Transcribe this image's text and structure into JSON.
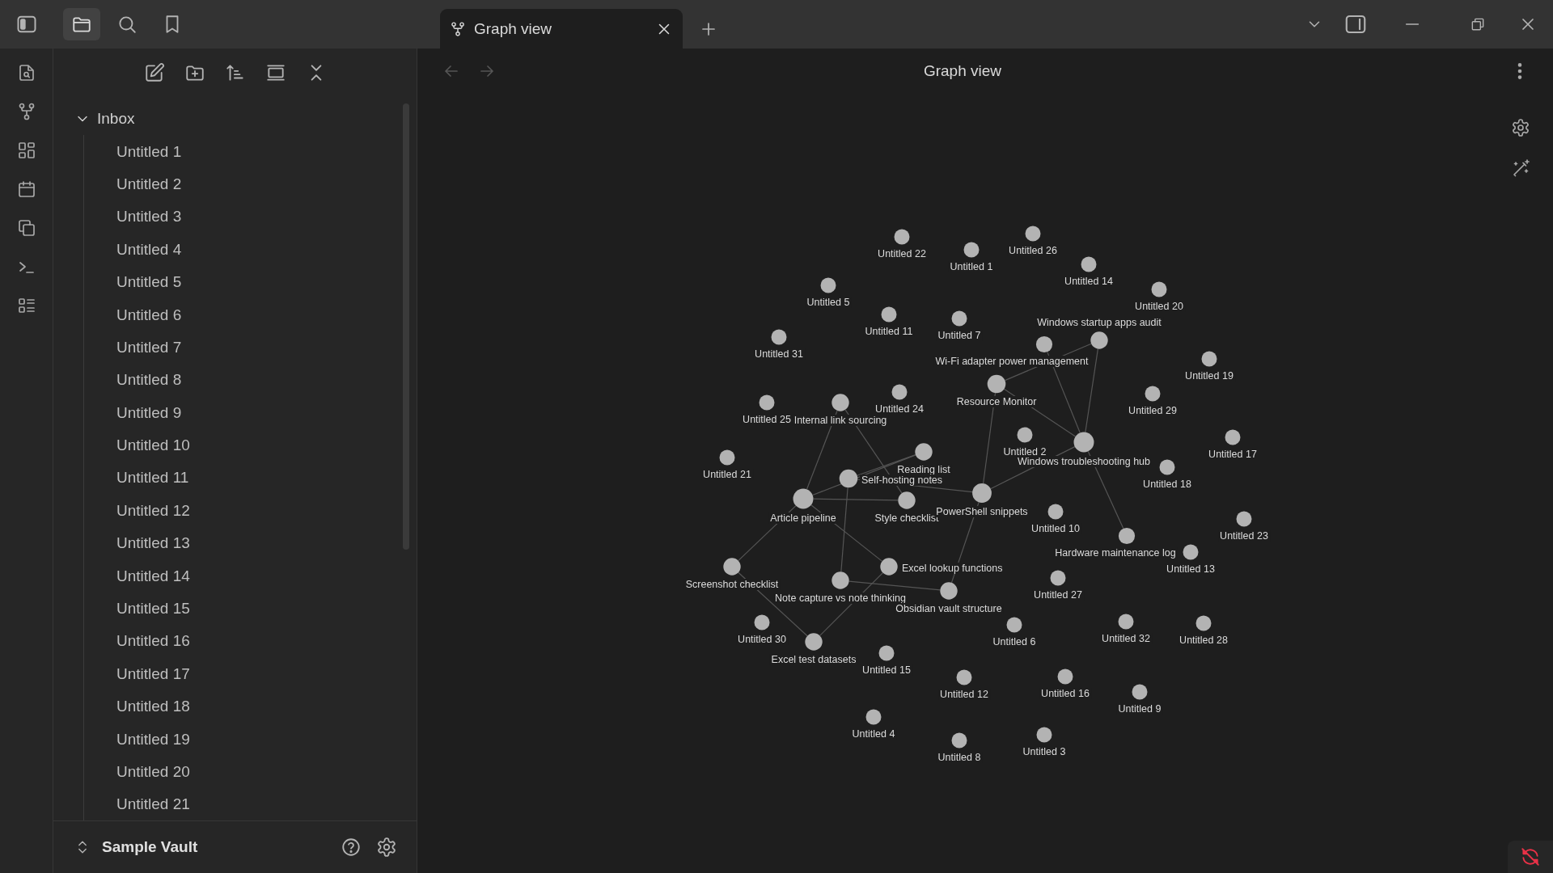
{
  "sidebar_tabs": [
    {
      "kind": "files",
      "selected": true
    },
    {
      "kind": "search",
      "selected": false
    },
    {
      "kind": "bookmarks",
      "selected": false
    }
  ],
  "tabs": [
    {
      "label": "Graph view",
      "selected": true
    }
  ],
  "explorer": {
    "tree": [
      {
        "label": "Inbox",
        "expanded": true,
        "children": [
          {
            "label": "Untitled 1"
          },
          {
            "label": "Untitled 2"
          },
          {
            "label": "Untitled 3"
          },
          {
            "label": "Untitled 4"
          },
          {
            "label": "Untitled 5"
          },
          {
            "label": "Untitled 6"
          },
          {
            "label": "Untitled 7"
          },
          {
            "label": "Untitled 8"
          },
          {
            "label": "Untitled 9"
          },
          {
            "label": "Untitled 10"
          },
          {
            "label": "Untitled 11"
          },
          {
            "label": "Untitled 12"
          },
          {
            "label": "Untitled 13"
          },
          {
            "label": "Untitled 14"
          },
          {
            "label": "Untitled 15"
          },
          {
            "label": "Untitled 16"
          },
          {
            "label": "Untitled 17"
          },
          {
            "label": "Untitled 18"
          },
          {
            "label": "Untitled 19"
          },
          {
            "label": "Untitled 20"
          },
          {
            "label": "Untitled 21"
          }
        ]
      }
    ],
    "vault": "Sample Vault"
  },
  "graph_view": {
    "title": "Graph view",
    "back": {
      "disabled": true
    },
    "forward": {
      "disabled": true
    },
    "nodes": [
      {
        "label": "Untitled 22"
      },
      {
        "label": "Untitled 1"
      },
      {
        "label": "Untitled 26"
      },
      {
        "label": "Untitled 14"
      },
      {
        "label": "Untitled 20"
      },
      {
        "label": "Untitled 5"
      },
      {
        "label": "Untitled 11"
      },
      {
        "label": "Untitled 7"
      },
      {
        "label": "Untitled 31"
      },
      {
        "label": "Wi-Fi adapter power management"
      },
      {
        "label": "Windows startup apps audit"
      },
      {
        "label": "Untitled 19"
      },
      {
        "label": "Resource Monitor"
      },
      {
        "label": "Untitled 29"
      },
      {
        "label": "Untitled 25"
      },
      {
        "label": "Internal link sourcing"
      },
      {
        "label": "Untitled 24"
      },
      {
        "label": "Untitled 2"
      },
      {
        "label": "Windows troubleshooting hub"
      },
      {
        "label": "Untitled 17"
      },
      {
        "label": "Untitled 21"
      },
      {
        "label": "Reading list"
      },
      {
        "label": "Untitled 18"
      },
      {
        "label": "Self-hosting notes"
      },
      {
        "label": "Article pipeline"
      },
      {
        "label": "Style checklist"
      },
      {
        "label": "PowerShell snippets"
      },
      {
        "label": "Untitled 10"
      },
      {
        "label": "Hardware maintenance log"
      },
      {
        "label": "Untitled 23"
      },
      {
        "label": "Untitled 13"
      },
      {
        "label": "Screenshot checklist"
      },
      {
        "label": "Note capture vs note thinking"
      },
      {
        "label": "Excel lookup functions"
      },
      {
        "label": "Obsidian vault structure"
      },
      {
        "label": "Untitled 27"
      },
      {
        "label": "Untitled 30"
      },
      {
        "label": "Excel test datasets"
      },
      {
        "label": "Untitled 6"
      },
      {
        "label": "Untitled 32"
      },
      {
        "label": "Untitled 28"
      },
      {
        "label": "Untitled 15"
      },
      {
        "label": "Untitled 12"
      },
      {
        "label": "Untitled 16"
      },
      {
        "label": "Untitled 9"
      },
      {
        "label": "Untitled 4"
      },
      {
        "label": "Untitled 8"
      },
      {
        "label": "Untitled 3"
      }
    ]
  },
  "status_bar": {
    "sync_error": true
  }
}
